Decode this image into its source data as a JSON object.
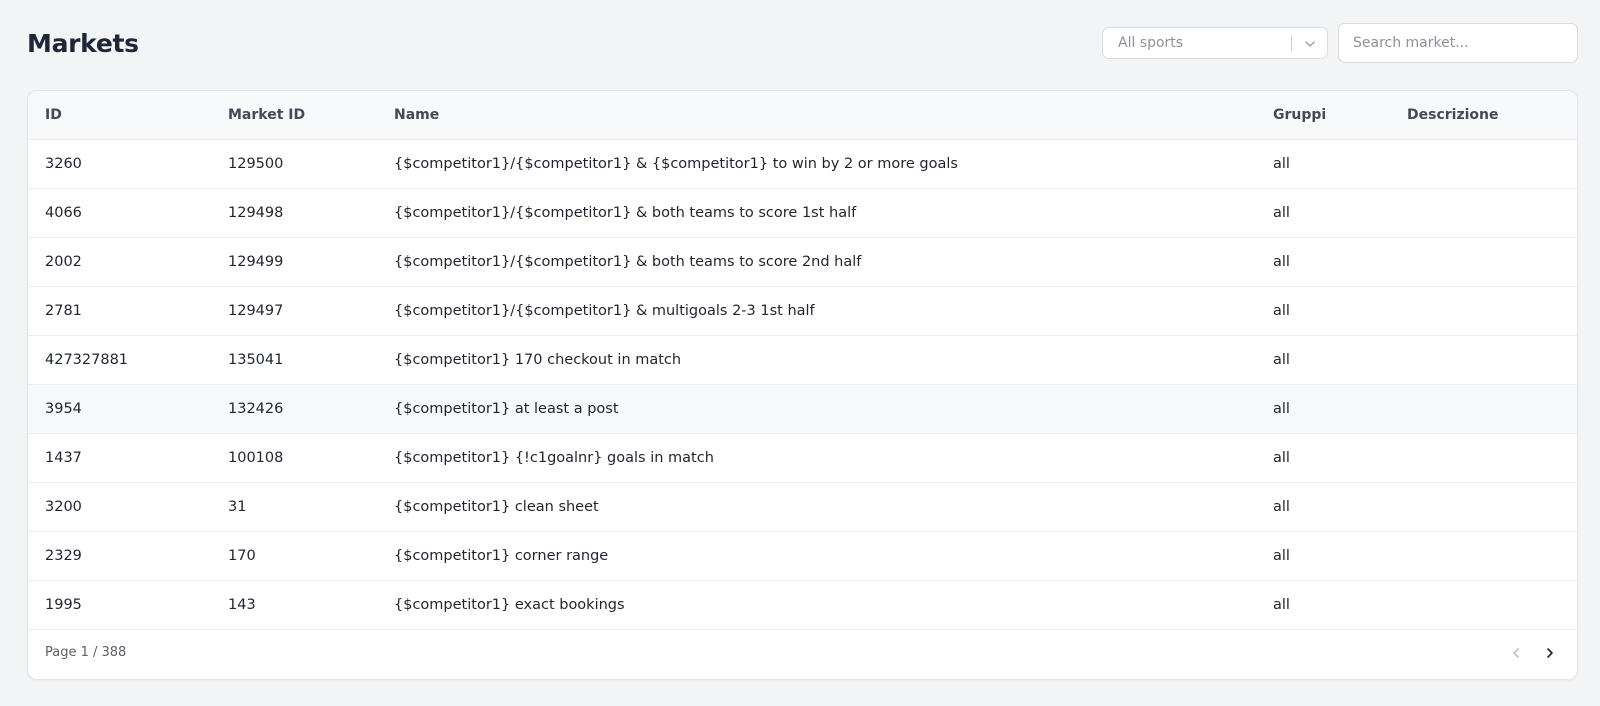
{
  "page": {
    "title": "Markets"
  },
  "filters": {
    "sport_select": {
      "value": "All sports",
      "icon": "chevron-down-icon"
    },
    "search": {
      "placeholder": "Search market...",
      "value": ""
    }
  },
  "table": {
    "columns": [
      "ID",
      "Market ID",
      "Name",
      "Gruppi",
      "Descrizione"
    ],
    "rows": [
      {
        "id": "3260",
        "market_id": "129500",
        "name": "{$competitor1}/{$competitor1} & {$competitor1} to win by 2 or more goals",
        "gruppi": "all",
        "descrizione": ""
      },
      {
        "id": "4066",
        "market_id": "129498",
        "name": "{$competitor1}/{$competitor1} & both teams to score 1st half",
        "gruppi": "all",
        "descrizione": ""
      },
      {
        "id": "2002",
        "market_id": "129499",
        "name": "{$competitor1}/{$competitor1} & both teams to score 2nd half",
        "gruppi": "all",
        "descrizione": ""
      },
      {
        "id": "2781",
        "market_id": "129497",
        "name": "{$competitor1}/{$competitor1} & multigoals 2-3 1st half",
        "gruppi": "all",
        "descrizione": ""
      },
      {
        "id": "427327881",
        "market_id": "135041",
        "name": "{$competitor1} 170 checkout in match",
        "gruppi": "all",
        "descrizione": ""
      },
      {
        "id": "3954",
        "market_id": "132426",
        "name": "{$competitor1} at least a post",
        "gruppi": "all",
        "descrizione": ""
      },
      {
        "id": "1437",
        "market_id": "100108",
        "name": "{$competitor1} {!c1goalnr} goals in match",
        "gruppi": "all",
        "descrizione": ""
      },
      {
        "id": "3200",
        "market_id": "31",
        "name": "{$competitor1} clean sheet",
        "gruppi": "all",
        "descrizione": ""
      },
      {
        "id": "2329",
        "market_id": "170",
        "name": "{$competitor1} corner range",
        "gruppi": "all",
        "descrizione": ""
      },
      {
        "id": "1995",
        "market_id": "143",
        "name": "{$competitor1} exact bookings",
        "gruppi": "all",
        "descrizione": ""
      }
    ],
    "hovered_row": 5
  },
  "pagination": {
    "label": "Page 1 / 388",
    "current_page": 1,
    "total_pages": 388,
    "prev_icon": "chevron-left-icon",
    "next_icon": "chevron-right-icon"
  },
  "colors": {
    "background": "#f3f4f6",
    "card": "#ffffff",
    "header_bg": "#f8f9fa",
    "hover_row": "#f7f8fa",
    "text": "#1f2430",
    "muted": "#8b929c"
  }
}
